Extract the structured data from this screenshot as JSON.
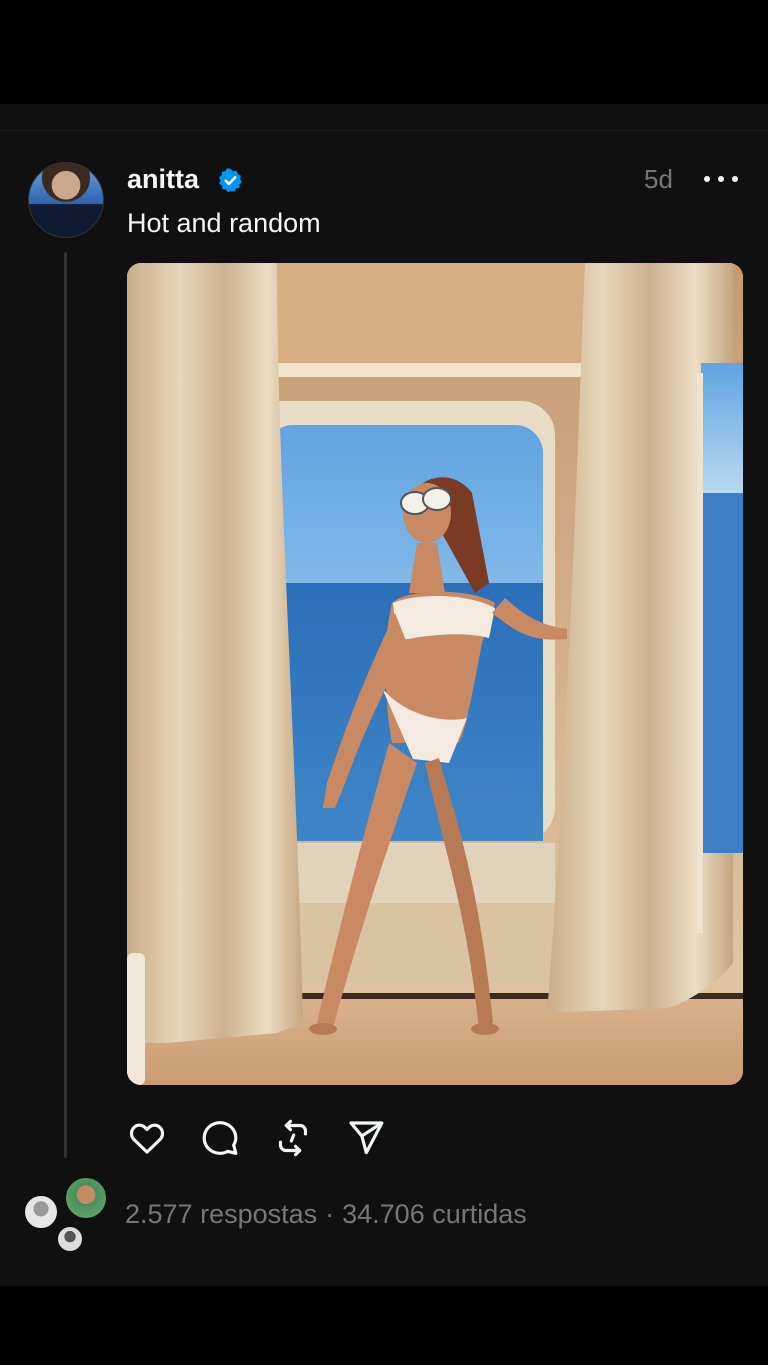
{
  "post": {
    "username": "anitta",
    "verified": true,
    "time_ago": "5d",
    "caption": "Hot and random",
    "media": {
      "description_icon": "photo"
    },
    "actions": [
      {
        "name": "like",
        "icon": "heart-icon"
      },
      {
        "name": "reply",
        "icon": "comment-icon"
      },
      {
        "name": "repost",
        "icon": "repost-icon"
      },
      {
        "name": "share",
        "icon": "send-icon"
      }
    ],
    "stats": {
      "replies": "2.577 respostas",
      "separator": "·",
      "likes": "34.706 curtidas"
    }
  },
  "colors": {
    "background": "#101010",
    "text_primary": "#f3f5f7",
    "text_secondary": "#777777",
    "verified_blue": "#0095f6"
  }
}
